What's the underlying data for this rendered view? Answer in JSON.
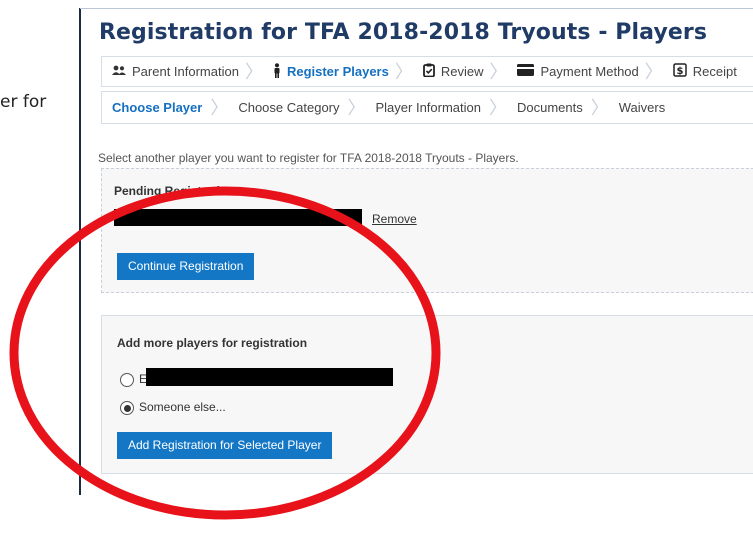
{
  "side_text": "er for",
  "title": "Registration for TFA 2018-2018 Tryouts - Players",
  "steps": [
    {
      "label": "Parent Information",
      "icon": "users-icon",
      "active": false
    },
    {
      "label": "Register Players",
      "icon": "person-icon",
      "active": true
    },
    {
      "label": "Review",
      "icon": "clipboard-icon",
      "active": false
    },
    {
      "label": "Payment Method",
      "icon": "credit-card-icon",
      "active": false
    },
    {
      "label": "Receipt",
      "icon": "receipt-icon",
      "active": false
    }
  ],
  "subtabs": [
    {
      "label": "Choose Player",
      "active": true
    },
    {
      "label": "Choose Category",
      "active": false
    },
    {
      "label": "Player Information",
      "active": false
    },
    {
      "label": "Documents",
      "active": false
    },
    {
      "label": "Waivers",
      "active": false
    }
  ],
  "intro": "Select another player you want to register for TFA 2018-2018 Tryouts - Players.",
  "pending": {
    "title": "Pending Registrations",
    "remove_label": "Remove",
    "continue_label": "Continue Registration"
  },
  "add_players": {
    "title": "Add more players for registration",
    "option_existing_prefix": "E",
    "option_someone_else": "Someone else...",
    "selected_option": "Someone else...",
    "add_button": "Add Registration for Selected Player"
  },
  "colors": {
    "accent": "#1570c2",
    "button": "#1477c6",
    "title": "#1f3b66",
    "annotation_circle": "#e8121a"
  }
}
